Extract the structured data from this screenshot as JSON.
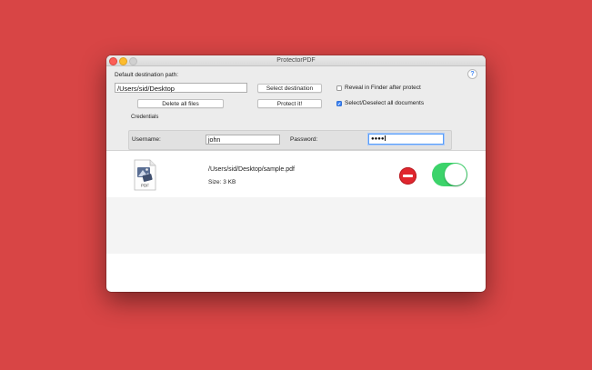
{
  "window": {
    "title": "ProtectorPDF"
  },
  "top": {
    "dest_label": "Default destination path:",
    "dest_value": "/Users/sid/Desktop",
    "select_dest_label": "Select destination",
    "reveal_label": "Reveal in Finder after protect",
    "reveal_checked": false,
    "delete_all_label": "Delete all files",
    "protect_label": "Protect it!",
    "select_all_label": "Select/Deselect all documents",
    "select_all_checked": true,
    "help_glyph": "?"
  },
  "credentials": {
    "section_label": "Credentials",
    "username_label": "Username:",
    "username_value": "john",
    "password_label": "Password:",
    "password_masked": "●●●●"
  },
  "files": [
    {
      "path": "/Users/sid/Desktop/sample.pdf",
      "size": "Size: 3 KB",
      "icon_text": "PDF",
      "enabled": true
    }
  ],
  "colors": {
    "background": "#d84545",
    "toggle_on": "#3cd36a",
    "remove": "#e0262e",
    "accent": "#3b83f6"
  }
}
